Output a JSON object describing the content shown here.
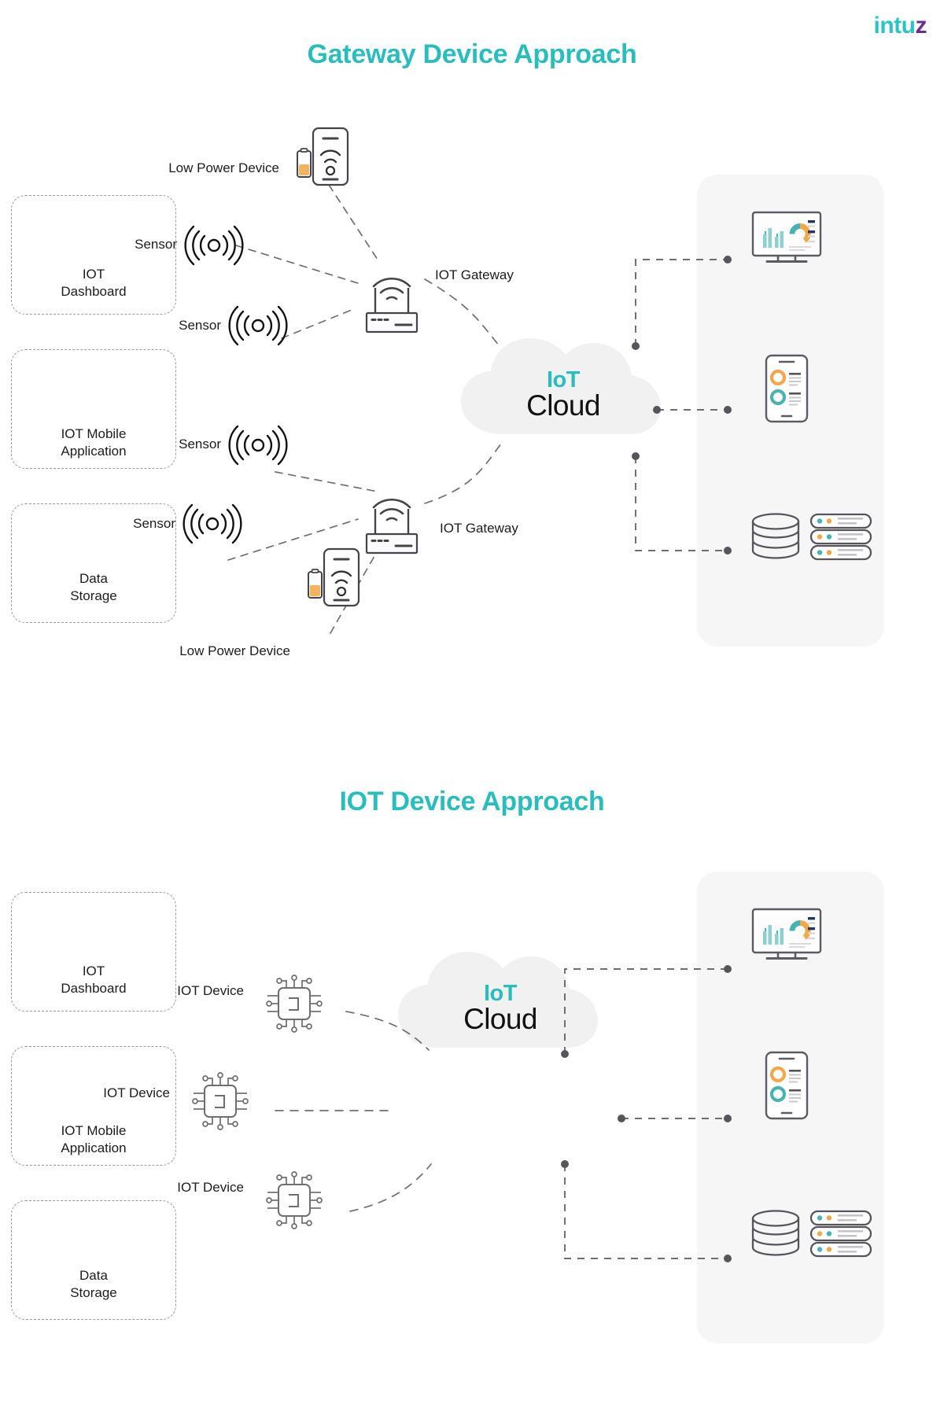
{
  "brand": {
    "name_main": "intu",
    "name_accent": "z",
    "teal": "#2bc4c4",
    "purple": "#6b2d8f"
  },
  "sections": [
    {
      "title": "Gateway Device Approach",
      "cloud": {
        "line1": "IoT",
        "line2": "Cloud"
      },
      "left_nodes": [
        {
          "label": "Low Power Device",
          "icon": "low-power-device-icon"
        },
        {
          "label": "Sensor",
          "icon": "sensor-icon"
        },
        {
          "label": "Sensor",
          "icon": "sensor-icon"
        },
        {
          "label": "Sensor",
          "icon": "sensor-icon"
        },
        {
          "label": "Sensor",
          "icon": "sensor-icon"
        },
        {
          "label": "Low Power Device",
          "icon": "low-power-device-icon"
        }
      ],
      "gateways": [
        {
          "label": "IOT Gateway",
          "icon": "router-icon"
        },
        {
          "label": "IOT Gateway",
          "icon": "router-icon"
        }
      ],
      "cards": [
        {
          "label_line1": "IOT",
          "label_line2": "Dashboard",
          "icon": "dashboard-monitor-icon"
        },
        {
          "label_line1": "IOT Mobile",
          "label_line2": "Application",
          "icon": "mobile-app-icon"
        },
        {
          "label_line1": "Data",
          "label_line2": "Storage",
          "icon": "data-storage-icon"
        }
      ]
    },
    {
      "title": "IOT Device Approach",
      "cloud": {
        "line1": "IoT",
        "line2": "Cloud"
      },
      "left_nodes": [
        {
          "label": "IOT Device",
          "icon": "chip-icon"
        },
        {
          "label": "IOT Device",
          "icon": "chip-icon"
        },
        {
          "label": "IOT Device",
          "icon": "chip-icon"
        }
      ],
      "cards": [
        {
          "label_line1": "IOT",
          "label_line2": "Dashboard",
          "icon": "dashboard-monitor-icon"
        },
        {
          "label_line1": "IOT Mobile",
          "label_line2": "Application",
          "icon": "mobile-app-icon"
        },
        {
          "label_line1": "Data",
          "label_line2": "Storage",
          "icon": "data-storage-icon"
        }
      ]
    }
  ],
  "palette": {
    "title_teal": "#2bbcbc",
    "line_gray": "#6e6e73",
    "stroke_dark": "#545458",
    "accent_orange": "#f0a84b",
    "accent_teal": "#49b3b3",
    "accent_navy": "#1f3864",
    "panel_bg": "#f6f6f7",
    "cloud_bg": "#f1f1f2"
  }
}
